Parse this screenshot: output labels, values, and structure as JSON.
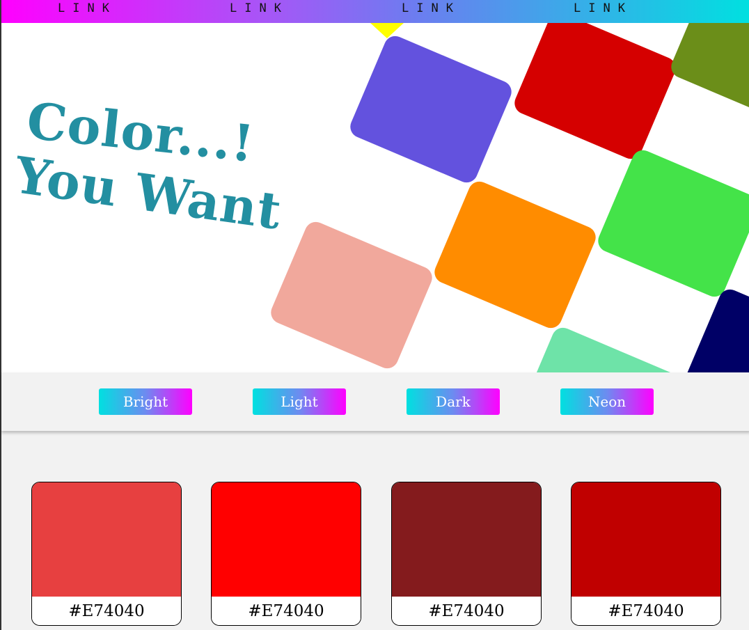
{
  "nav": {
    "links": [
      "LINK",
      "LINK",
      "LINK",
      "LINK"
    ]
  },
  "hero": {
    "title_line1": "Color...!",
    "title_line2": "You Want",
    "tile_colors": [
      "#6352de",
      "#d50000",
      "#6b8e19",
      "#44e349",
      "#ff8c00",
      "#f1a89c",
      "#000066",
      "#6ee3a8"
    ],
    "pointer_color": "#ffff00",
    "title_color": "#238fa1"
  },
  "filters": [
    {
      "label": "Bright"
    },
    {
      "label": "Light"
    },
    {
      "label": "Dark"
    },
    {
      "label": "Neon"
    }
  ],
  "cards": [
    {
      "color": "#e74040",
      "hex": "#E74040"
    },
    {
      "color": "#ff0000",
      "hex": "#E74040"
    },
    {
      "color": "#841b1d",
      "hex": "#E74040"
    },
    {
      "color": "#c00000",
      "hex": "#E74040"
    }
  ]
}
